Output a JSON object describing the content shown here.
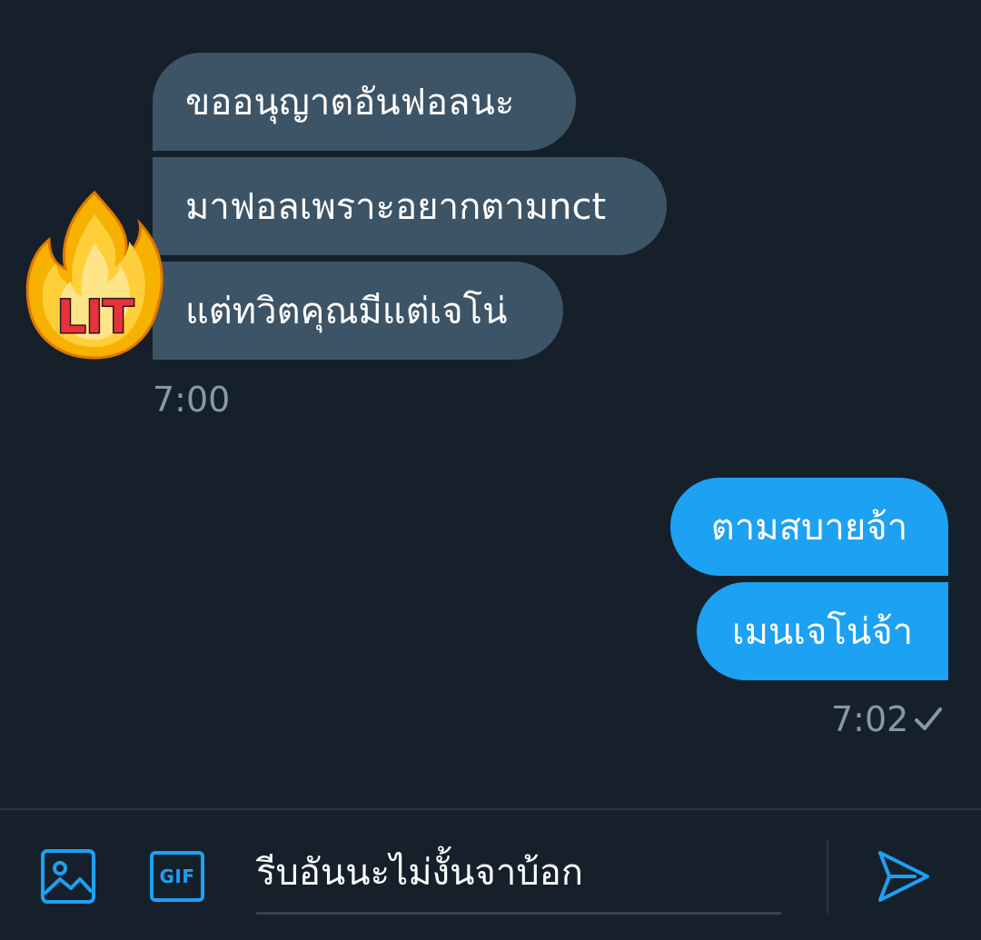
{
  "conversation": {
    "incoming": {
      "avatar_sticker": "LIT",
      "messages": [
        "ขออนุญาตอันฟอลนะ",
        "มาฟอลเพราะอยากตามnct",
        "แต่ทวิตคุณมีแต่เจโน่"
      ],
      "timestamp": "7:00"
    },
    "outgoing": {
      "messages": [
        "ตามสบายจ้า",
        "เมนเจโน่จ้า"
      ],
      "timestamp": "7:02",
      "status_icon": "check-icon"
    }
  },
  "composer": {
    "image_icon": "image-icon",
    "gif_label": "GIF",
    "input_value": "รีบอันนะไม่งั้นจาบ้อก",
    "send_icon": "send-icon"
  },
  "colors": {
    "background": "#15202b",
    "incoming_bubble": "#3d5466",
    "outgoing_bubble": "#1da1f2",
    "accent": "#1da1f2",
    "muted_text": "#8899a6"
  }
}
